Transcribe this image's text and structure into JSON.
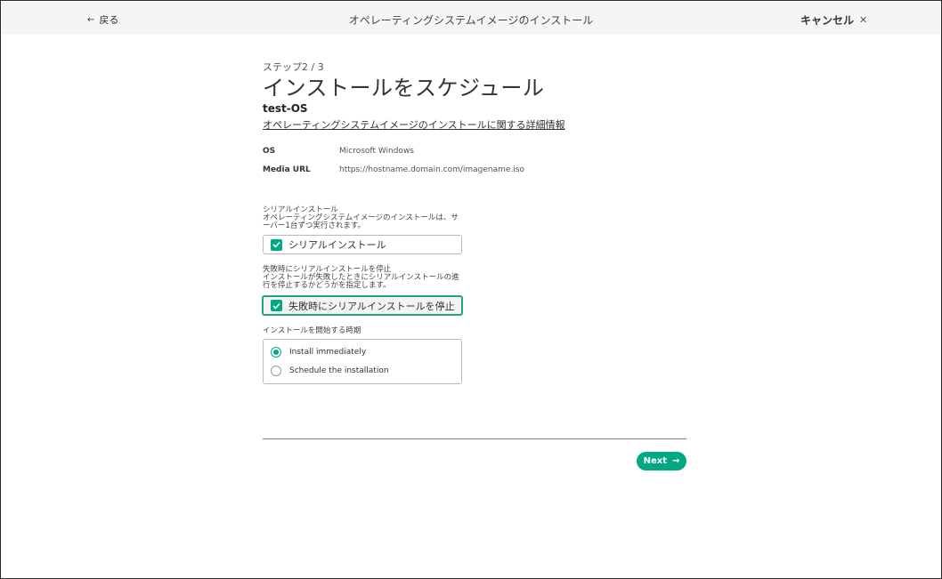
{
  "header": {
    "back_label": "戻る",
    "title": "オペレーティングシステムイメージのインストール",
    "cancel_label": "キャンセル"
  },
  "step": {
    "indicator": "ステップ2 / 3",
    "title": "インストールをスケジュール",
    "name": "test-OS",
    "details_link": "オペレーティングシステムイメージのインストールに関する詳細情報"
  },
  "info": {
    "os_label": "OS",
    "os_value": "Microsoft Windows",
    "media_label": "Media URL",
    "media_value": "https://hostname.domain.com/imagename.iso"
  },
  "serial": {
    "title": "シリアルインストール",
    "description": "オペレーティングシステムイメージのインストールは、サーバー1台ずつ実行されます。",
    "checkbox_label": "シリアルインストール",
    "checked": true
  },
  "stop_on_failure": {
    "title": "失敗時にシリアルインストールを停止",
    "description": "インストールが失敗したときにシリアルインストールの進行を停止するかどうかを指定します。",
    "checkbox_label": "失敗時にシリアルインストールを停止",
    "checked": true
  },
  "timing": {
    "title": "インストールを開始する時期",
    "options": [
      {
        "label": "Install immediately",
        "selected": true
      },
      {
        "label": "Schedule the installation",
        "selected": false
      }
    ]
  },
  "footer": {
    "next_label": "Next"
  },
  "colors": {
    "accent": "#01a982",
    "topbar": "#f5f5f5"
  }
}
